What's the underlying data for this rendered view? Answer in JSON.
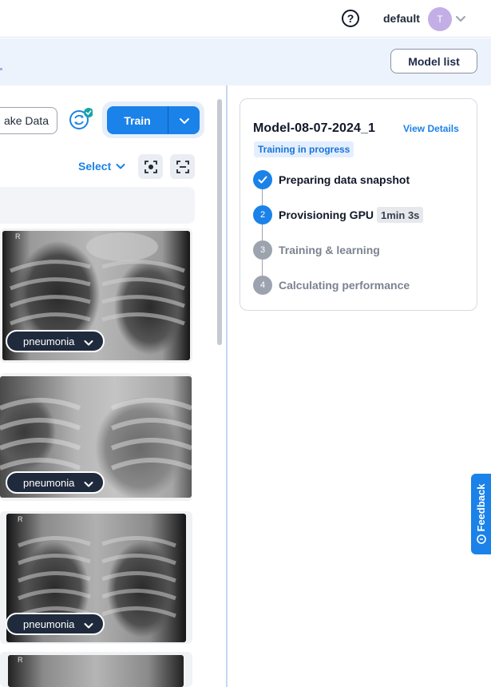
{
  "header": {
    "help_glyph": "?",
    "username": "default",
    "avatar_initial": "T",
    "avatar_color": "#c3aee6"
  },
  "subbar": {
    "model_list_label": "Model list"
  },
  "toolbar": {
    "fake_data_label": "ake Data",
    "train_label": "Train",
    "select_label": "Select",
    "accent_color": "#1a82e8"
  },
  "images": [
    {
      "label": "pneumonia",
      "corner_mark": "R"
    },
    {
      "label": "pneumonia",
      "corner_mark": ""
    },
    {
      "label": "pneumonia",
      "corner_mark": "R"
    },
    {
      "label": "",
      "corner_mark": "R"
    }
  ],
  "training_panel": {
    "model_name": "Model-08-07-2024_1",
    "view_details_label": "View Details",
    "status": "Training in progress",
    "steps": [
      {
        "number": "1",
        "label": "Preparing data snapshot",
        "state": "done"
      },
      {
        "number": "2",
        "label": "Provisioning GPU",
        "state": "active",
        "elapsed": "1min 3s"
      },
      {
        "number": "3",
        "label": "Training & learning",
        "state": "pending"
      },
      {
        "number": "4",
        "label": "Calculating performance",
        "state": "pending"
      }
    ]
  },
  "feedback": {
    "label": "Feedback"
  }
}
